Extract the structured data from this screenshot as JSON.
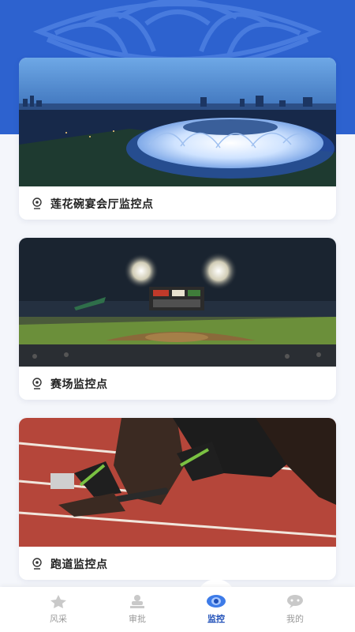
{
  "colors": {
    "brand_blue": "#2d62cf",
    "active_tab": "#1f4fb8",
    "inactive_tab": "#9a9a9a"
  },
  "cards": [
    {
      "title": "莲花碗宴会厅监控点",
      "icon": "camera-icon",
      "image": "lotus-stadium-night-photo"
    },
    {
      "title": "赛场监控点",
      "icon": "camera-icon",
      "image": "baseball-stadium-night-photo"
    },
    {
      "title": "跑道监控点",
      "icon": "camera-icon",
      "image": "runner-on-track-photo"
    }
  ],
  "tabs": [
    {
      "label": "风采",
      "icon": "star-icon",
      "active": false
    },
    {
      "label": "审批",
      "icon": "stamp-icon",
      "active": false
    },
    {
      "label": "监控",
      "icon": "eye-icon",
      "active": true
    },
    {
      "label": "我的",
      "icon": "chat-icon",
      "active": false
    }
  ]
}
